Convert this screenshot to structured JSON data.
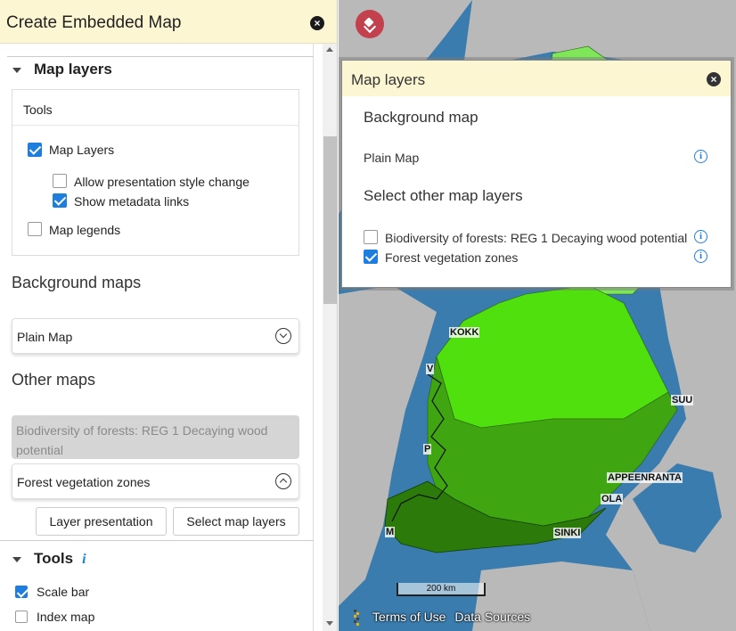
{
  "left_panel": {
    "title": "Create Embedded Map",
    "close_icon": "close-icon",
    "map_layers_section": {
      "heading": "Map layers",
      "tools_title": "Tools",
      "options": [
        {
          "label": "Map Layers",
          "checked": true
        },
        {
          "label": "Allow presentation style change",
          "checked": false
        },
        {
          "label": "Show metadata links",
          "checked": true
        },
        {
          "label": "Map legends",
          "checked": false
        }
      ]
    },
    "background_maps": {
      "heading": "Background maps",
      "selected": "Plain Map"
    },
    "other_maps": {
      "heading": "Other maps",
      "items": [
        {
          "label": "Biodiversity of forests: REG 1 Decaying wood potential",
          "disabled": true
        },
        {
          "label": "Forest vegetation zones",
          "expanded": true
        }
      ]
    },
    "buttons": {
      "layer_presentation": "Layer presentation",
      "select_map_layers": "Select map layers"
    },
    "tools_section": {
      "heading": "Tools",
      "options": [
        {
          "label": "Scale bar",
          "checked": true
        },
        {
          "label": "Index map",
          "checked": false
        }
      ]
    }
  },
  "map": {
    "popup": {
      "title": "Map layers",
      "background_heading": "Background map",
      "background_item": "Plain Map",
      "other_heading": "Select other map layers",
      "layers": [
        {
          "label": "Biodiversity of forests: REG 1 Decaying wood potential",
          "checked": false
        },
        {
          "label": "Forest vegetation zones",
          "checked": true
        }
      ]
    },
    "city_labels": {
      "kokk": "KOKK",
      "suu": "SUU",
      "lappeenranta": "APPEENRANTA",
      "kotka": "OLA",
      "helsinki": "SINKI",
      "p": "P",
      "m": "M",
      "v": "V"
    },
    "scale_label": "200 km",
    "footer": {
      "terms": "Terms of Use",
      "sources": "Data Sources"
    },
    "colors": {
      "sea": "#3a7cae",
      "land": "#b9b9b9",
      "zone_light": "#7fe65a",
      "zone_bright": "#4fe00e",
      "zone_mid": "#3fa511",
      "zone_dark": "#2b7a0a"
    }
  }
}
